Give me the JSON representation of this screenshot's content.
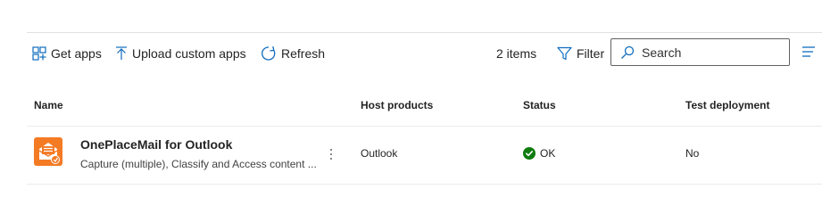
{
  "toolbar": {
    "get_apps": "Get apps",
    "upload_custom_apps": "Upload custom apps",
    "refresh": "Refresh",
    "items_count": "2 items",
    "filter": "Filter",
    "search_placeholder": "Search"
  },
  "table": {
    "columns": [
      "Name",
      "Host products",
      "Status",
      "Test deployment"
    ],
    "rows": [
      {
        "name": "OnePlaceMail for Outlook",
        "description": "Capture (multiple), Classify and Access content ...",
        "host_products": "Outlook",
        "status": "OK",
        "test_deployment": "No"
      }
    ]
  },
  "colors": {
    "accent": "#0f6cbd",
    "status_ok": "#107c10",
    "app_icon_orange": "#f47a24"
  },
  "icons": {
    "get_apps": "grid-plus-icon",
    "upload": "upload-arrow-icon",
    "refresh": "refresh-icon",
    "filter": "funnel-icon",
    "search": "search-icon",
    "status_ok": "checkmark-circle-icon",
    "more": "more-vertical-icon",
    "list_view": "list-view-icon"
  }
}
